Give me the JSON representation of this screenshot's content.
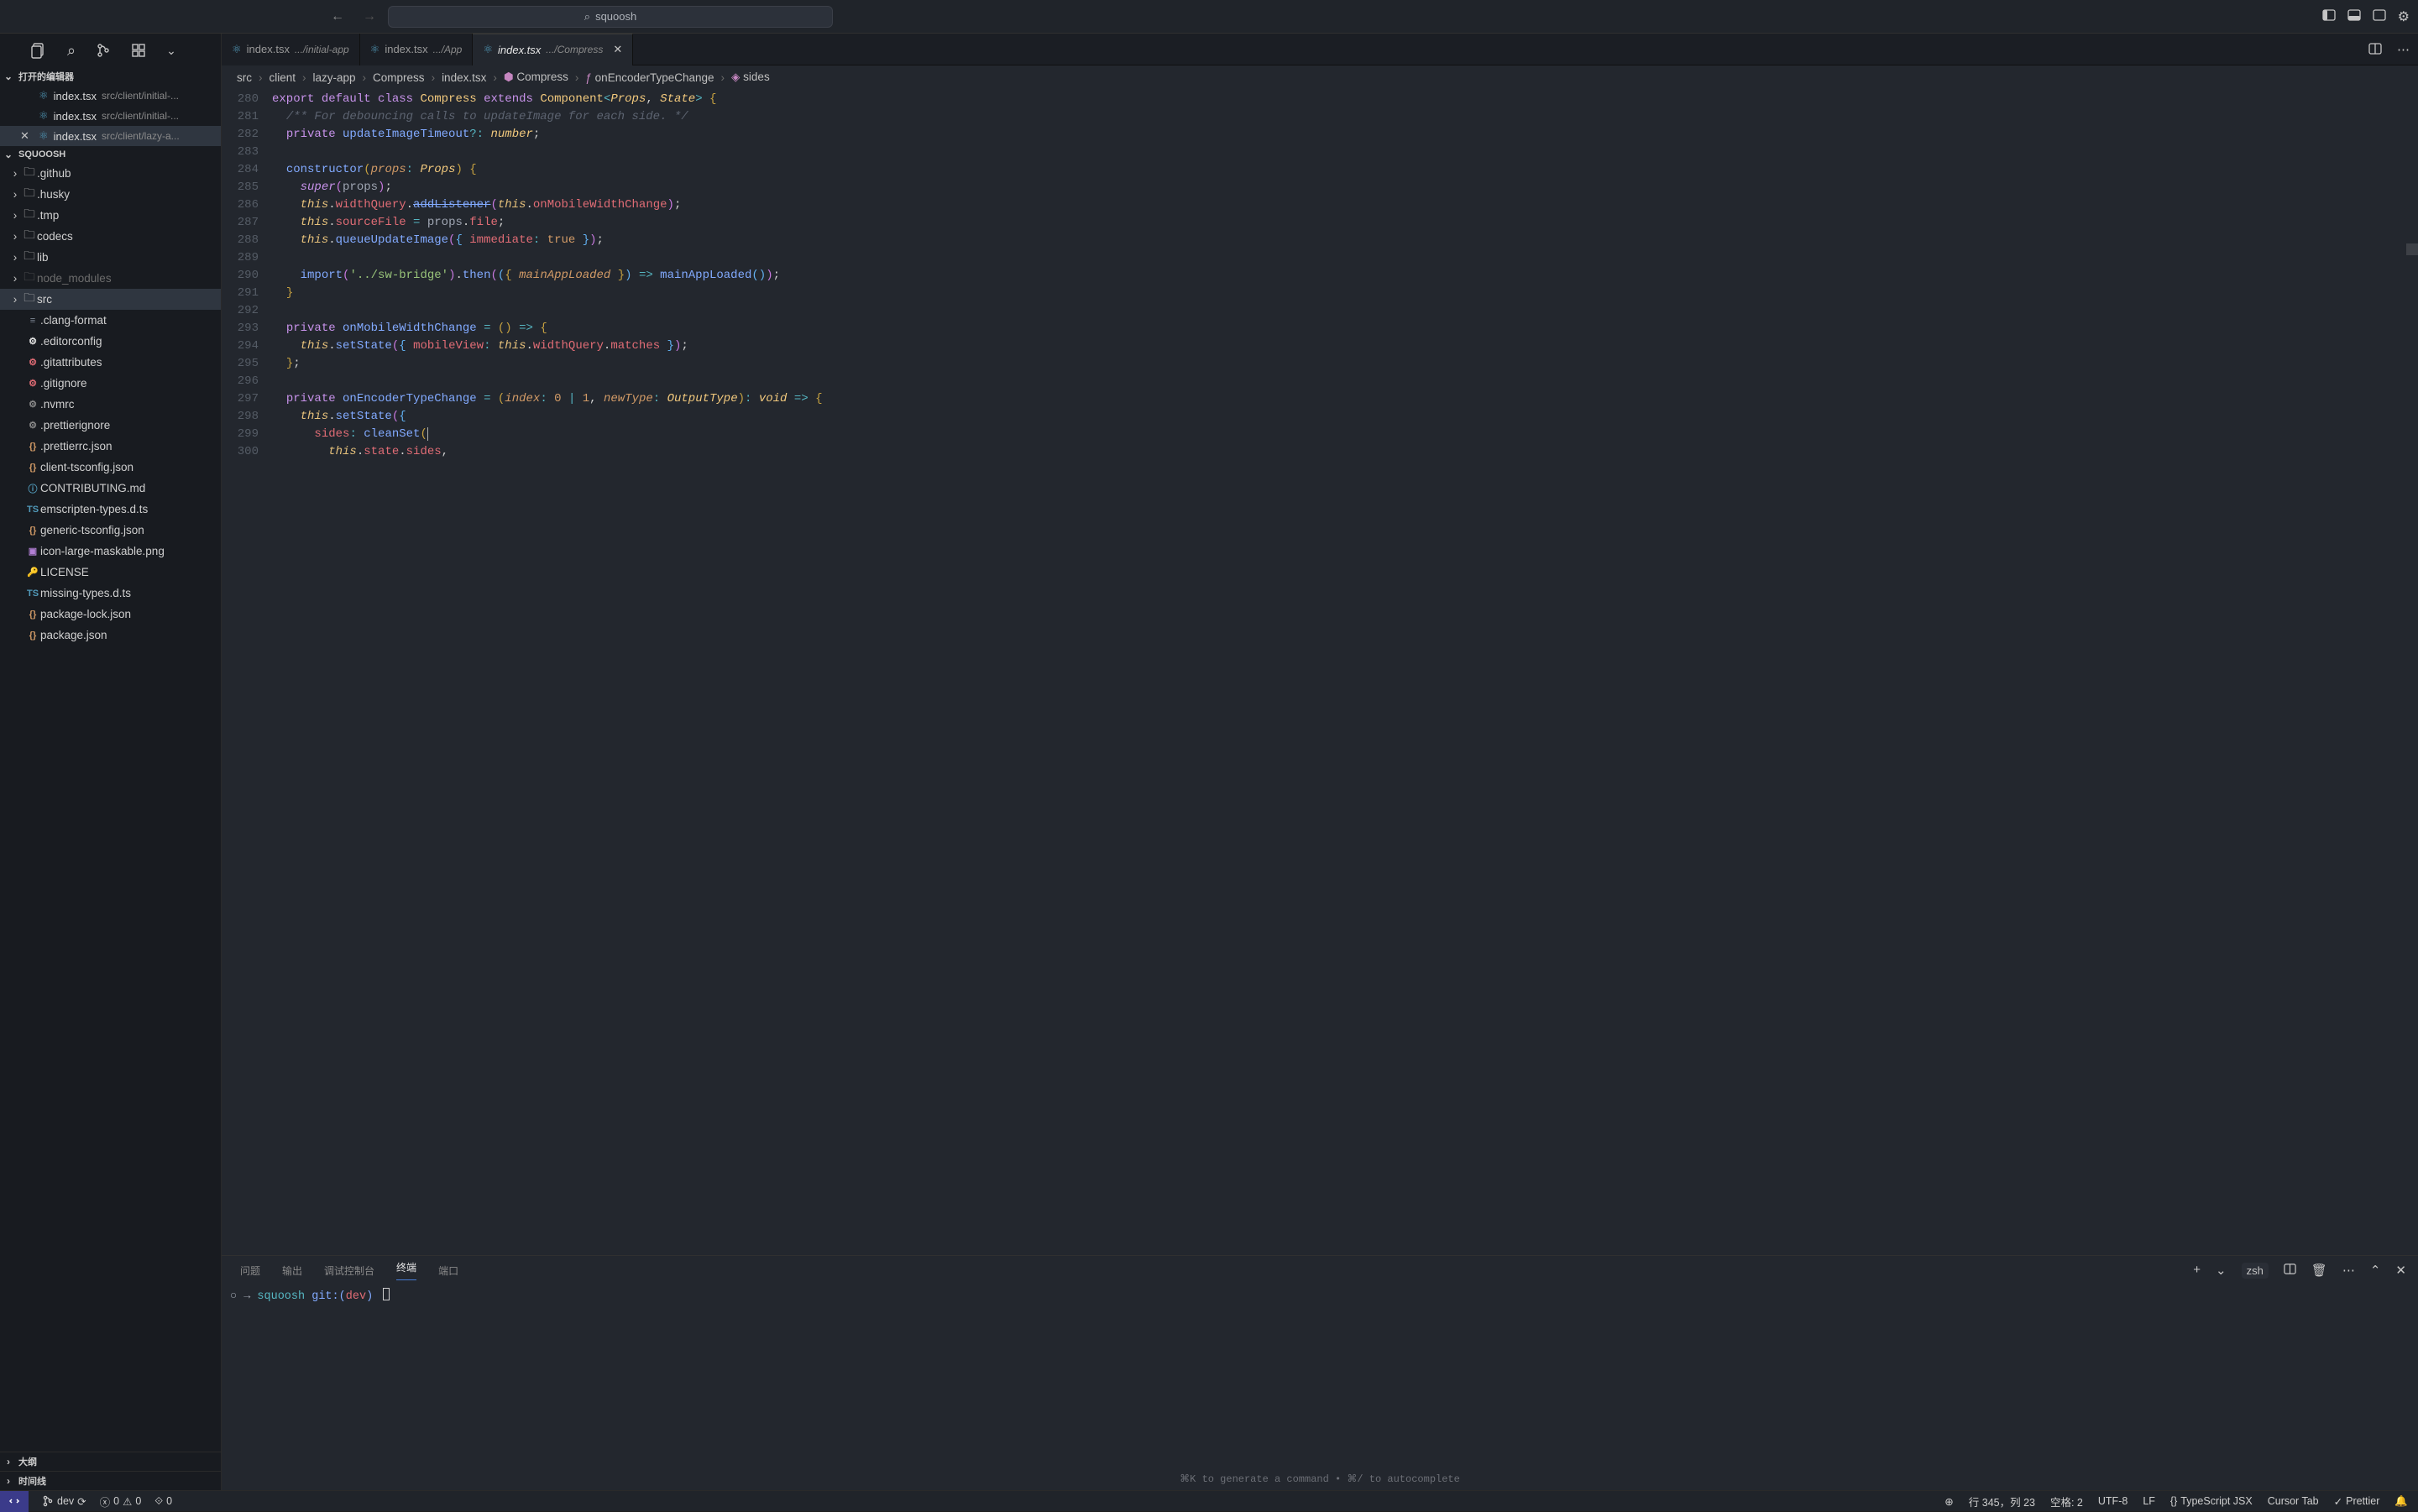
{
  "titlebar": {
    "search_text": "squoosh"
  },
  "sidebar": {
    "open_editors_label": "打开的编辑器",
    "open_editors": [
      {
        "name": "index.tsx",
        "path": "src/client/initial-..."
      },
      {
        "name": "index.tsx",
        "path": "src/client/initial-..."
      },
      {
        "name": "index.tsx",
        "path": "src/client/lazy-a..."
      }
    ],
    "project_label": "SQUOOSH",
    "folders": [
      {
        "name": ".github",
        "icon": "📁"
      },
      {
        "name": ".husky",
        "icon": "📁"
      },
      {
        "name": ".tmp",
        "icon": "📁"
      },
      {
        "name": "codecs",
        "icon": "📁"
      },
      {
        "name": "lib",
        "icon": "📁"
      },
      {
        "name": "node_modules",
        "icon": "📁",
        "dim": true
      },
      {
        "name": "src",
        "icon": "📁",
        "selected": true
      }
    ],
    "files": [
      {
        "name": ".clang-format",
        "icon": "≡",
        "c": "#7f8896"
      },
      {
        "name": ".editorconfig",
        "icon": "⚙",
        "c": "#e6e6e6"
      },
      {
        "name": ".gitattributes",
        "icon": "⚙",
        "c": "#e06c75"
      },
      {
        "name": ".gitignore",
        "icon": "⚙",
        "c": "#e06c75"
      },
      {
        "name": ".nvmrc",
        "icon": "⚙",
        "c": "#8a8a8a"
      },
      {
        "name": ".prettierignore",
        "icon": "⚙",
        "c": "#8a8a8a"
      },
      {
        "name": ".prettierrc.json",
        "icon": "{}",
        "c": "#d19a66"
      },
      {
        "name": "client-tsconfig.json",
        "icon": "{}",
        "c": "#d19a66"
      },
      {
        "name": "CONTRIBUTING.md",
        "icon": "ⓘ",
        "c": "#519aba"
      },
      {
        "name": "emscripten-types.d.ts",
        "icon": "TS",
        "c": "#519aba"
      },
      {
        "name": "generic-tsconfig.json",
        "icon": "{}",
        "c": "#d19a66"
      },
      {
        "name": "icon-large-maskable.png",
        "icon": "▣",
        "c": "#b17fd4"
      },
      {
        "name": "LICENSE",
        "icon": "🔑",
        "c": "#d7ba7d"
      },
      {
        "name": "missing-types.d.ts",
        "icon": "TS",
        "c": "#519aba"
      },
      {
        "name": "package-lock.json",
        "icon": "{}",
        "c": "#d19a66"
      },
      {
        "name": "package.json",
        "icon": "{}",
        "c": "#d19a66"
      }
    ],
    "outline_label": "大纲",
    "timeline_label": "时间线"
  },
  "tabs": [
    {
      "name": "index.tsx",
      "path": ".../initial-app",
      "active": false
    },
    {
      "name": "index.tsx",
      "path": ".../App",
      "active": false
    },
    {
      "name": "index.tsx",
      "path": ".../Compress",
      "active": true,
      "italic": true
    }
  ],
  "breadcrumb": [
    "src",
    "client",
    "lazy-app",
    "Compress",
    "index.tsx",
    "Compress",
    "onEncoderTypeChange",
    "sides"
  ],
  "code": {
    "start": 280,
    "lines": [
      "<span class='kw'>export</span> <span class='kw'>default</span> <span class='kw'>class</span> <span class='cls'>Compress</span> <span class='kw'>extends</span> <span class='cls'>Component</span><span class='op'>&lt;</span><span class='type'>Props</span>, <span class='type'>State</span><span class='op'>&gt;</span> <span class='paren'>{</span>",
      "  <span class='com'>/** For debouncing calls to updateImage for each side. */</span>",
      "  <span class='kw'>private</span> <span class='fn'>updateImageTimeout</span><span class='op'>?:</span> <span class='type'>number</span>;",
      "",
      "  <span class='fn'>constructor</span><span class='paren'>(</span><span class='param'>props</span><span class='op'>:</span> <span class='type'>Props</span><span class='paren'>)</span> <span class='paren'>{</span>",
      "    <span class='kw2'>super</span><span class='paren2'>(</span><span class='priv'>props</span><span class='paren2'>)</span>;",
      "    <span class='this'>this</span>.<span class='prop'>widthQuery</span>.<span class='fn strike'>addListener</span><span class='paren2'>(</span><span class='this'>this</span>.<span class='prop'>onMobileWidthChange</span><span class='paren2'>)</span>;",
      "    <span class='this'>this</span>.<span class='prop'>sourceFile</span> <span class='op'>=</span> <span class='priv'>props</span>.<span class='prop'>file</span>;",
      "    <span class='this'>this</span>.<span class='fn'>queueUpdateImage</span><span class='paren2'>(</span><span class='paren3'>{</span> <span class='prop'>immediate</span><span class='op'>:</span> <span class='num'>true</span> <span class='paren3'>}</span><span class='paren2'>)</span>;",
      "",
      "    <span class='fn'>import</span><span class='paren2'>(</span><span class='str'>'../sw-bridge'</span><span class='paren2'>)</span>.<span class='fn'>then</span><span class='paren2'>(</span><span class='paren3'>(</span><span class='paren'>{</span> <span class='param'>mainAppLoaded</span> <span class='paren'>}</span><span class='paren3'>)</span> <span class='op'>=&gt;</span> <span class='fn'>mainAppLoaded</span><span class='paren3'>(</span><span class='paren3'>)</span><span class='paren2'>)</span>;",
      "  <span class='paren'>}</span>",
      "",
      "  <span class='kw'>private</span> <span class='fn'>onMobileWidthChange</span> <span class='op'>=</span> <span class='paren'>(</span><span class='paren'>)</span> <span class='op'>=&gt;</span> <span class='paren'>{</span>",
      "    <span class='this'>this</span>.<span class='fn'>setState</span><span class='paren2'>(</span><span class='paren3'>{</span> <span class='prop'>mobileView</span><span class='op'>:</span> <span class='this'>this</span>.<span class='prop'>widthQuery</span>.<span class='prop'>matches</span> <span class='paren3'>}</span><span class='paren2'>)</span>;",
      "  <span class='paren'>}</span>;",
      "",
      "  <span class='kw'>private</span> <span class='fn'>onEncoderTypeChange</span> <span class='op'>=</span> <span class='paren'>(</span><span class='param'>index</span><span class='op'>:</span> <span class='num'>0</span> <span class='op'>|</span> <span class='num'>1</span>, <span class='param'>newType</span><span class='op'>:</span> <span class='type'>OutputType</span><span class='paren'>)</span><span class='op'>:</span> <span class='type'>void</span> <span class='op'>=&gt;</span> <span class='paren'>{</span>",
      "    <span class='this'>this</span>.<span class='fn'>setState</span><span class='paren2'>(</span><span class='paren3'>{</span>",
      "      <span class='prop'>sides</span><span class='op'>:</span> <span class='fn'>cleanSet</span><span class='paren'>(</span><span style='border-left:1px solid #aeafad;'></span>",
      "        <span class='this'>this</span>.<span class='prop'>state</span>.<span class='prop'>sides</span>,"
    ]
  },
  "panel": {
    "tabs": {
      "problems": "问题",
      "output": "输出",
      "debug": "调试控制台",
      "terminal": "终端",
      "ports": "端口"
    },
    "shell": "zsh",
    "prompt_project": "squoosh",
    "prompt_git": "git:",
    "prompt_branch": "dev",
    "hint": "⌘K to generate a command • ⌘/ to autocomplete"
  },
  "status": {
    "branch": "dev",
    "errors": "0",
    "warnings": "0",
    "ports": "0",
    "pos": "行 345，列 23",
    "spaces": "空格: 2",
    "encoding": "UTF-8",
    "eol": "LF",
    "lang": "TypeScript JSX",
    "cursor_tab": "Cursor Tab",
    "prettier": "Prettier"
  }
}
